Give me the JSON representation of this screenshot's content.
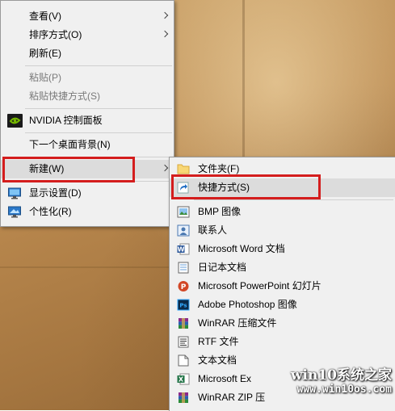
{
  "context_menu": {
    "items": [
      {
        "label": "查看(V)"
      },
      {
        "label": "排序方式(O)"
      },
      {
        "label": "刷新(E)"
      },
      {
        "label": "粘贴(P)"
      },
      {
        "label": "粘贴快捷方式(S)"
      },
      {
        "label": "NVIDIA 控制面板"
      },
      {
        "label": "下一个桌面背景(N)"
      },
      {
        "label": "新建(W)"
      },
      {
        "label": "显示设置(D)"
      },
      {
        "label": "个性化(R)"
      }
    ]
  },
  "new_submenu": {
    "items": [
      {
        "label": "文件夹(F)",
        "icon": "folder-icon"
      },
      {
        "label": "快捷方式(S)",
        "icon": "shortcut-icon"
      },
      {
        "label": "BMP 图像",
        "icon": "bmp-image-icon"
      },
      {
        "label": "联系人",
        "icon": "contact-icon"
      },
      {
        "label": "Microsoft Word 文档",
        "icon": "word-icon"
      },
      {
        "label": "日记本文档",
        "icon": "journal-icon"
      },
      {
        "label": "Microsoft PowerPoint 幻灯片",
        "icon": "powerpoint-icon"
      },
      {
        "label": "Adobe Photoshop 图像",
        "icon": "photoshop-icon"
      },
      {
        "label": "WinRAR 压缩文件",
        "icon": "winrar-icon"
      },
      {
        "label": "RTF 文件",
        "icon": "rtf-icon"
      },
      {
        "label": "文本文档",
        "icon": "text-document-icon"
      },
      {
        "label": "Microsoft Ex",
        "icon": "excel-icon"
      },
      {
        "label": "WinRAR ZIP 压",
        "icon": "winrar-zip-icon"
      }
    ]
  },
  "watermark": {
    "title": "win10系统之家",
    "url": "www.win10os.com"
  },
  "colors": {
    "highlight_box": "#d41d1d",
    "menu_background": "#f0f0f0",
    "nvidia_green": "#76b900"
  }
}
